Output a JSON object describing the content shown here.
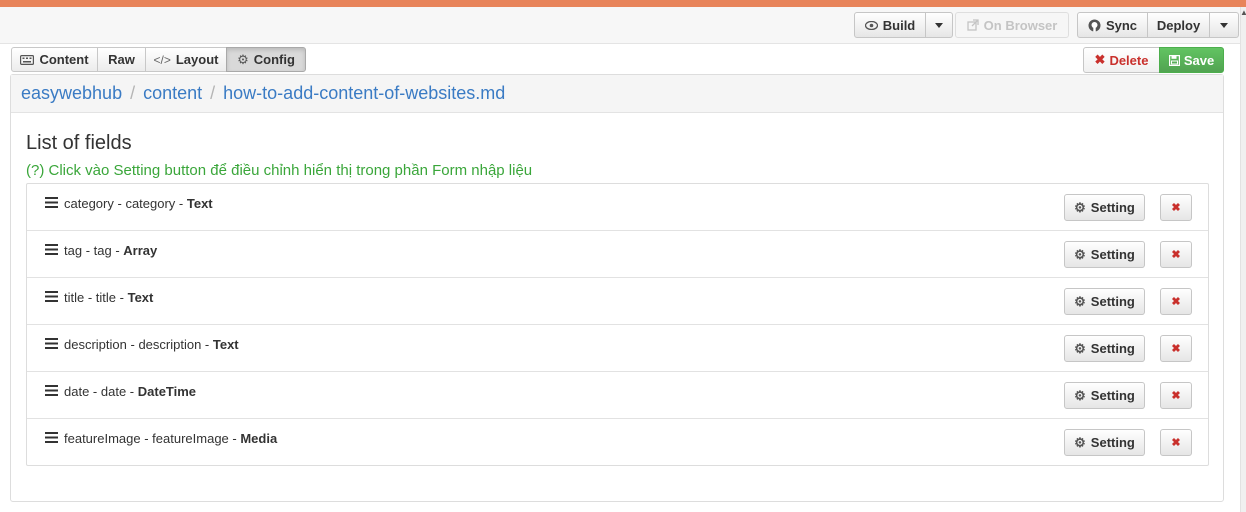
{
  "toolbar": {
    "build_label": "Build",
    "on_browser_label": "On Browser",
    "sync_label": "Sync",
    "deploy_label": "Deploy"
  },
  "tabs": [
    {
      "label": "Content",
      "icon": "keyboard-icon"
    },
    {
      "label": "Raw",
      "icon": ""
    },
    {
      "label": "Layout",
      "icon": "code-icon"
    },
    {
      "label": "Config",
      "icon": "gear-icon",
      "active": true
    }
  ],
  "actions": {
    "delete_label": "Delete",
    "save_label": "Save"
  },
  "breadcrumb": [
    "easywebhub",
    "content",
    "how-to-add-content-of-websites.md"
  ],
  "list": {
    "title": "List of fields",
    "hint": "(?) Click vào Setting button để điều chỉnh hiển thị trong phần Form nhập liệu",
    "setting_label": "Setting",
    "fields": [
      {
        "name": "category",
        "key": "category",
        "type": "Text"
      },
      {
        "name": "tag",
        "key": "tag",
        "type": "Array"
      },
      {
        "name": "title",
        "key": "title",
        "type": "Text"
      },
      {
        "name": "description",
        "key": "description",
        "type": "Text"
      },
      {
        "name": "date",
        "key": "date",
        "type": "DateTime"
      },
      {
        "name": "featureImage",
        "key": "featureImage",
        "type": "Media"
      }
    ]
  },
  "colors": {
    "link": "#3a7bc4",
    "hint": "#3aa63a",
    "delete": "#c9302c",
    "save": "#5cb85c",
    "top_stripe": "#e8845a"
  }
}
